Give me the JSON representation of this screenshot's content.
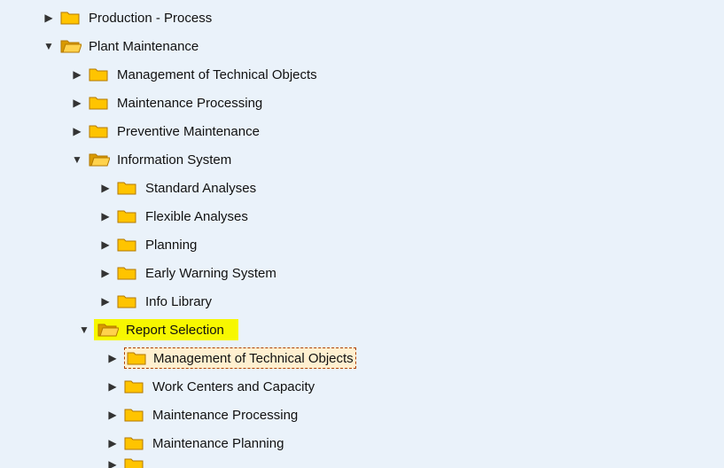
{
  "tree": {
    "production_process": "Production - Process",
    "plant_maintenance": "Plant Maintenance",
    "pm_children": {
      "mgmt_tech_objects": "Management of Technical Objects",
      "maint_processing": "Maintenance Processing",
      "prev_maint": "Preventive Maintenance",
      "info_system": "Information System"
    },
    "info_system_children": {
      "std_analyses": "Standard Analyses",
      "flex_analyses": "Flexible Analyses",
      "planning": "Planning",
      "early_warning": "Early Warning System",
      "info_library": "Info Library",
      "report_selection": "Report Selection"
    },
    "report_selection_children": {
      "mgmt_tech_objects": "Management of Technical Objects",
      "work_centers": "Work Centers and Capacity",
      "maint_processing": "Maintenance Processing",
      "maint_planning": "Maintenance Planning"
    }
  },
  "colors": {
    "folder_fill": "#ffc400",
    "folder_stroke": "#b37800",
    "highlight": "#f7f700",
    "selection_border": "#b04000"
  }
}
